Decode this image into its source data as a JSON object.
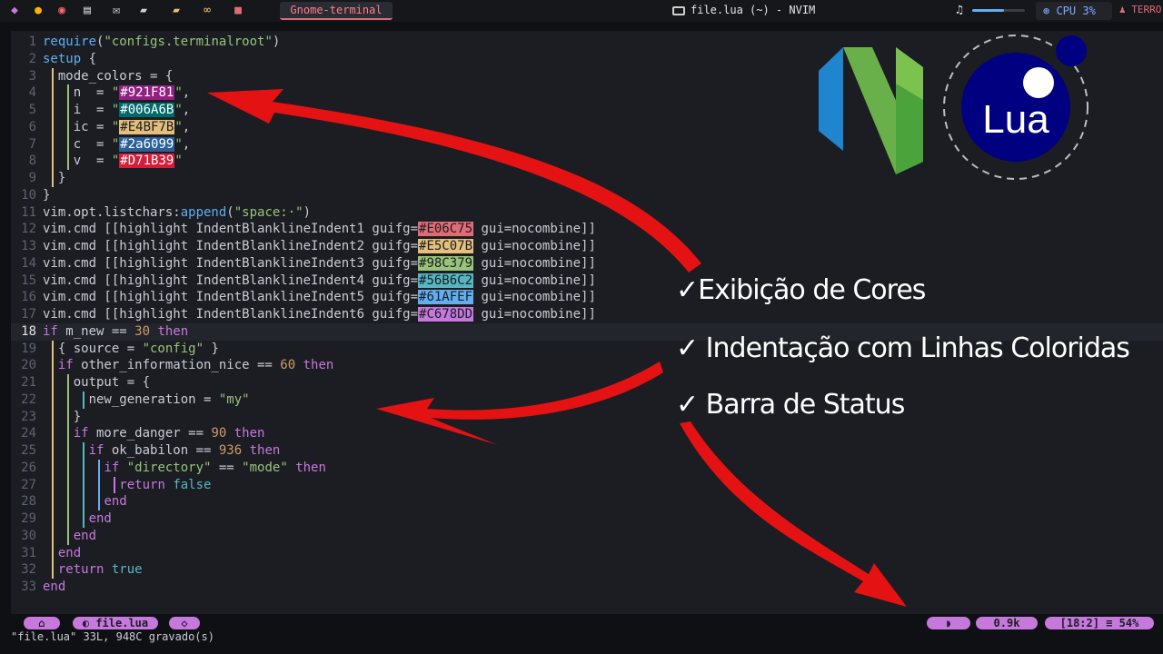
{
  "topbar": {
    "workspace": "Gnome-terminal",
    "window_title": "file.lua (~) - NVIM",
    "cpu": "CPU 3%",
    "user": "TERRO",
    "volume_fraction": 0.6,
    "icons": [
      "arch-icon",
      "firefox-icon",
      "chrome-icon",
      "terminal-icon",
      "mail-icon",
      "folder-icon",
      "gamepad-icon",
      "video-icon"
    ]
  },
  "code_lines": [
    "require(\"configs.terminalroot\")",
    "setup {",
    "  mode_colors = {",
    "    n  = \"#921F81\",",
    "    i  = \"#006A6B\",",
    "    ic = \"#E4BF7B\",",
    "    c  = \"#2a6099\",",
    "    v  = \"#D71B39\"",
    "  }",
    "}",
    "vim.opt.listchars:append(\"space:·\")",
    "vim.cmd [[highlight IndentBlanklineIndent1 guifg=#E06C75 gui=nocombine]]",
    "vim.cmd [[highlight IndentBlanklineIndent2 guifg=#E5C07B gui=nocombine]]",
    "vim.cmd [[highlight IndentBlanklineIndent3 guifg=#98C379 gui=nocombine]]",
    "vim.cmd [[highlight IndentBlanklineIndent4 guifg=#56B6C2 gui=nocombine]]",
    "vim.cmd [[highlight IndentBlanklineIndent5 guifg=#61AFEF gui=nocombine]]",
    "vim.cmd [[highlight IndentBlanklineIndent6 guifg=#C678DD gui=nocombine]]",
    "if m_new == 30 then",
    "  { source = \"config\" }",
    "  if other_information_nice == 60 then",
    "    output = {",
    "      new_generation = \"my\"",
    "    }",
    "    if more_danger == 90 then",
    "      if ok_babilon == 936 then",
    "        if \"directory\" == \"mode\" then",
    "          return false",
    "        end",
    "      end",
    "    end",
    "  end",
    "  return true",
    "end"
  ],
  "current_line": 18,
  "color_swatches": {
    "#921F81": "#921f81",
    "#006A6B": "#006a6b",
    "#E4BF7B": "#e4bf7b",
    "#2a6099": "#2a6099",
    "#D71B39": "#d71b39",
    "#E06C75": "#e06c75",
    "#E5C07B": "#e5c07b",
    "#98C379": "#98c379",
    "#56B6C2": "#56b6c2",
    "#61AFEF": "#61afef",
    "#C678DD": "#c678dd"
  },
  "indent_colors": [
    "#e5c07b",
    "#98c379",
    "#56b6c2",
    "#61afef",
    "#c678dd",
    "#e06c75"
  ],
  "logos": {
    "lua_text": "Lua"
  },
  "features": [
    "✓Exibição de Cores",
    "✓ Indentação com Linhas Coloridas",
    "✓ Barra de Status"
  ],
  "statusline": {
    "file": "file.lua",
    "size": "0.9k",
    "position": "[18:2]",
    "percent": "54%"
  },
  "cmdline": "\"file.lua\" 33L, 948C gravado(s)",
  "colors": {
    "accent": "#c678dd",
    "arrow": "#e01010",
    "background": "#1b1d23"
  }
}
